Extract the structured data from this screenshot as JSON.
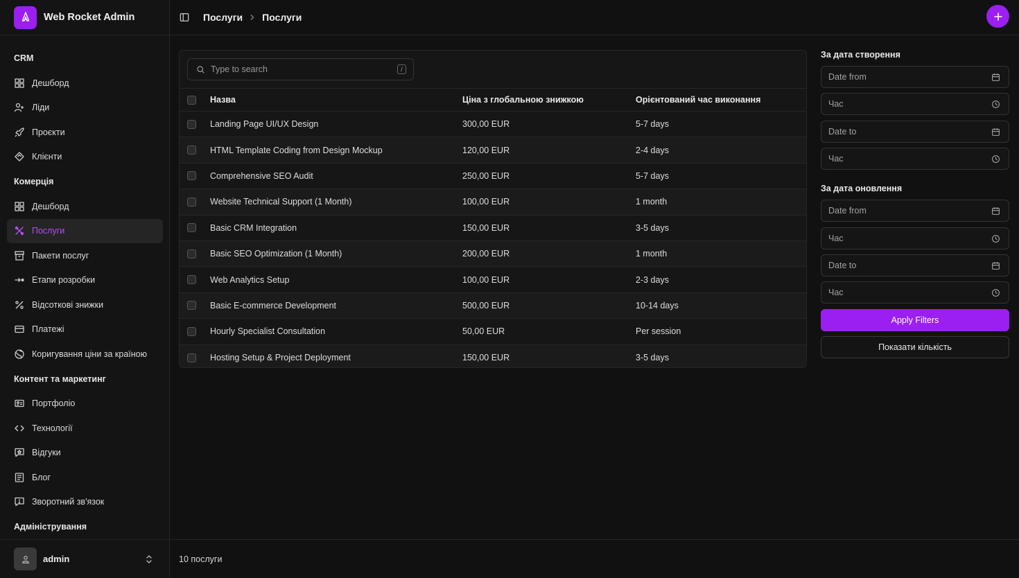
{
  "app": {
    "title": "Web Rocket Admin",
    "brand_color": "#9b1ff0"
  },
  "breadcrumb": [
    "Послуги",
    "Послуги"
  ],
  "sidebar": {
    "groups": [
      {
        "label": "CRM",
        "items": [
          {
            "label": "Дешборд",
            "icon": "dashboard-icon"
          },
          {
            "label": "Ліди",
            "icon": "users-icon"
          },
          {
            "label": "Проєкти",
            "icon": "rocket-icon"
          },
          {
            "label": "Клієнти",
            "icon": "handshake-icon"
          }
        ]
      },
      {
        "label": "Комерція",
        "items": [
          {
            "label": "Дешборд",
            "icon": "dashboard-icon"
          },
          {
            "label": "Послуги",
            "icon": "services-icon",
            "active": true
          },
          {
            "label": "Пакети послуг",
            "icon": "archive-icon"
          },
          {
            "label": "Етапи розробки",
            "icon": "stages-icon"
          },
          {
            "label": "Відсоткові знижки",
            "icon": "percent-icon"
          },
          {
            "label": "Платежі",
            "icon": "credit-card-icon"
          },
          {
            "label": "Коригування ціни за країною",
            "icon": "globe-icon"
          }
        ]
      },
      {
        "label": "Контент та маркетинг",
        "items": [
          {
            "label": "Портфоліо",
            "icon": "portfolio-icon"
          },
          {
            "label": "Технології",
            "icon": "code-icon"
          },
          {
            "label": "Відгуки",
            "icon": "review-icon"
          },
          {
            "label": "Блог",
            "icon": "blog-icon"
          },
          {
            "label": "Зворотний зв'язок",
            "icon": "feedback-icon"
          }
        ]
      },
      {
        "label": "Адміністрування",
        "items": []
      }
    ]
  },
  "user": {
    "name": "admin"
  },
  "search": {
    "placeholder": "Type to search",
    "shortcut": "/"
  },
  "table": {
    "columns": [
      "Назва",
      "Ціна з глобальною знижкою",
      "Орієнтований час виконання"
    ],
    "rows": [
      [
        "Landing Page UI/UX Design",
        "300,00 EUR",
        "5-7 days"
      ],
      [
        "HTML Template Coding from Design Mockup",
        "120,00 EUR",
        "2-4 days"
      ],
      [
        "Comprehensive SEO Audit",
        "250,00 EUR",
        "5-7 days"
      ],
      [
        "Website Technical Support (1 Month)",
        "100,00 EUR",
        "1 month"
      ],
      [
        "Basic CRM Integration",
        "150,00 EUR",
        "3-5 days"
      ],
      [
        "Basic SEO Optimization (1 Month)",
        "200,00 EUR",
        "1 month"
      ],
      [
        "Web Analytics Setup",
        "100,00 EUR",
        "2-3 days"
      ],
      [
        "Basic E-commerce Development",
        "500,00 EUR",
        "10-14 days"
      ],
      [
        "Hourly Specialist Consultation",
        "50,00 EUR",
        "Per session"
      ],
      [
        "Hosting Setup & Project Deployment",
        "150,00 EUR",
        "3-5 days"
      ]
    ]
  },
  "filters": {
    "created": {
      "title": "За дата створення",
      "date_from": "Date from",
      "time1": "Час",
      "date_to": "Date to",
      "time2": "Час"
    },
    "updated": {
      "title": "За дата оновлення",
      "date_from": "Date from",
      "time1": "Час",
      "date_to": "Date to",
      "time2": "Час"
    },
    "apply_label": "Apply Filters",
    "count_label": "Показати кількість"
  },
  "footer": {
    "count_text": "10 послуги"
  }
}
